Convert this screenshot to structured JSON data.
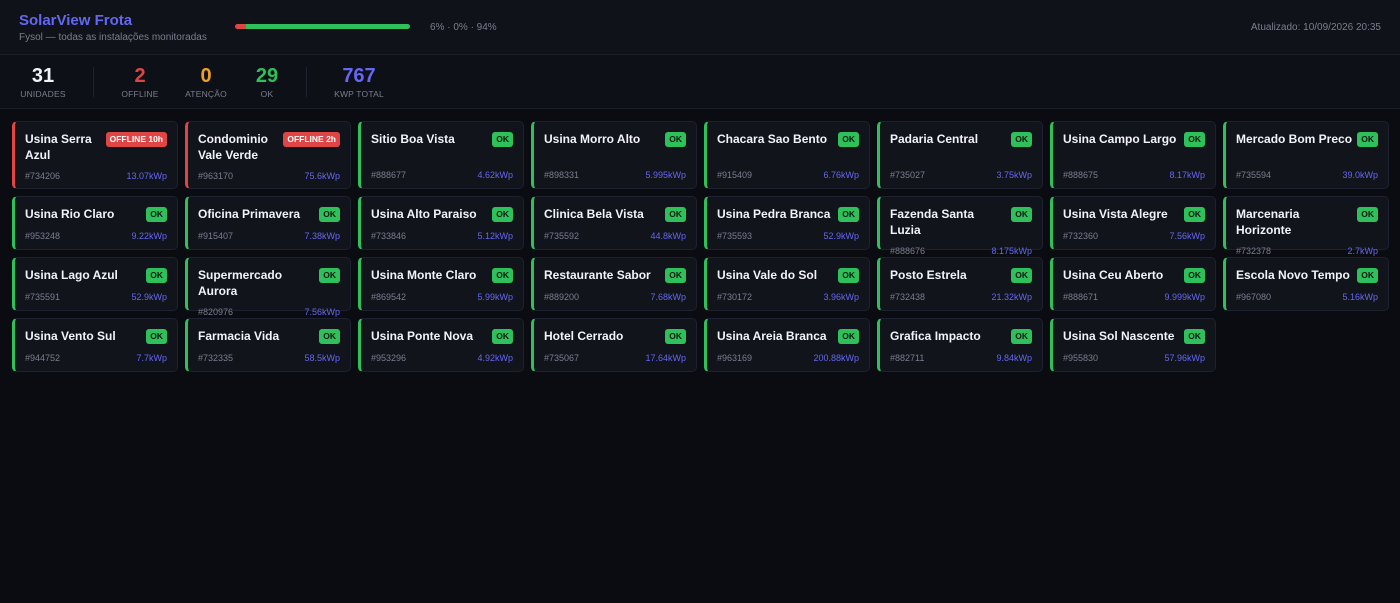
{
  "header": {
    "title": "SolarView Frota",
    "subtitle": "Fysol — todas as instalações monitoradas",
    "progress": {
      "offline_pct": 6,
      "attention_pct": 0,
      "ok_pct": 94,
      "text": "6% · 0% · 94%"
    },
    "updated": "Atualizado: 10/09/2026 20:35"
  },
  "colors": {
    "accent": "#6467f2",
    "offline": "#e04545",
    "attention": "#f0a020",
    "ok": "#2ec05a"
  },
  "stats": {
    "units": {
      "value": "31",
      "label": "UNIDADES"
    },
    "offline": {
      "value": "2",
      "label": "OFFLINE"
    },
    "attention": {
      "value": "0",
      "label": "ATENÇÃO"
    },
    "ok": {
      "value": "29",
      "label": "OK"
    },
    "kwp": {
      "value": "767",
      "label": "KWP TOTAL"
    }
  },
  "units": [
    {
      "name": "Usina Serra Azul",
      "status": "offline",
      "badge": "OFFLINE 10h",
      "id": "#734206",
      "kwp": "13.07kWp"
    },
    {
      "name": "Condominio Vale Verde",
      "status": "offline",
      "badge": "OFFLINE 2h",
      "id": "#963170",
      "kwp": "75.6kWp"
    },
    {
      "name": "Sitio Boa Vista",
      "status": "ok",
      "badge": "OK",
      "id": "#888677",
      "kwp": "4.62kWp"
    },
    {
      "name": "Usina Morro Alto",
      "status": "ok",
      "badge": "OK",
      "id": "#898331",
      "kwp": "5.995kWp"
    },
    {
      "name": "Chacara Sao Bento",
      "status": "ok",
      "badge": "OK",
      "id": "#915409",
      "kwp": "6.76kWp"
    },
    {
      "name": "Padaria Central",
      "status": "ok",
      "badge": "OK",
      "id": "#735027",
      "kwp": "3.75kWp"
    },
    {
      "name": "Usina Campo Largo",
      "status": "ok",
      "badge": "OK",
      "id": "#888675",
      "kwp": "8.17kWp"
    },
    {
      "name": "Mercado Bom Preco",
      "status": "ok",
      "badge": "OK",
      "id": "#735594",
      "kwp": "39.0kWp"
    },
    {
      "name": "Usina Rio Claro",
      "status": "ok",
      "badge": "OK",
      "id": "#953248",
      "kwp": "9.22kWp"
    },
    {
      "name": "Oficina Primavera",
      "status": "ok",
      "badge": "OK",
      "id": "#915407",
      "kwp": "7.38kWp"
    },
    {
      "name": "Usina Alto Paraiso",
      "status": "ok",
      "badge": "OK",
      "id": "#733846",
      "kwp": "5.12kWp"
    },
    {
      "name": "Clinica Bela Vista",
      "status": "ok",
      "badge": "OK",
      "id": "#735592",
      "kwp": "44.8kWp"
    },
    {
      "name": "Usina Pedra Branca",
      "status": "ok",
      "badge": "OK",
      "id": "#735593",
      "kwp": "52.9kWp"
    },
    {
      "name": "Fazenda Santa Luzia",
      "status": "ok",
      "badge": "OK",
      "id": "#888676",
      "kwp": "8.175kWp"
    },
    {
      "name": "Usina Vista Alegre",
      "status": "ok",
      "badge": "OK",
      "id": "#732360",
      "kwp": "7.56kWp"
    },
    {
      "name": "Marcenaria Horizonte",
      "status": "ok",
      "badge": "OK",
      "id": "#732378",
      "kwp": "2.7kWp"
    },
    {
      "name": "Usina Lago Azul",
      "status": "ok",
      "badge": "OK",
      "id": "#735591",
      "kwp": "52.9kWp"
    },
    {
      "name": "Supermercado Aurora",
      "status": "ok",
      "badge": "OK",
      "id": "#820976",
      "kwp": "7.56kWp"
    },
    {
      "name": "Usina Monte Claro",
      "status": "ok",
      "badge": "OK",
      "id": "#869542",
      "kwp": "5.99kWp"
    },
    {
      "name": "Restaurante Sabor",
      "status": "ok",
      "badge": "OK",
      "id": "#889200",
      "kwp": "7.68kWp"
    },
    {
      "name": "Usina Vale do Sol",
      "status": "ok",
      "badge": "OK",
      "id": "#730172",
      "kwp": "3.96kWp"
    },
    {
      "name": "Posto Estrela",
      "status": "ok",
      "badge": "OK",
      "id": "#732438",
      "kwp": "21.32kWp"
    },
    {
      "name": "Usina Ceu Aberto",
      "status": "ok",
      "badge": "OK",
      "id": "#888671",
      "kwp": "9.999kWp"
    },
    {
      "name": "Escola Novo Tempo",
      "status": "ok",
      "badge": "OK",
      "id": "#967080",
      "kwp": "5.16kWp"
    },
    {
      "name": "Usina Vento Sul",
      "status": "ok",
      "badge": "OK",
      "id": "#944752",
      "kwp": "7.7kWp"
    },
    {
      "name": "Farmacia Vida",
      "status": "ok",
      "badge": "OK",
      "id": "#732335",
      "kwp": "58.5kWp"
    },
    {
      "name": "Usina Ponte Nova",
      "status": "ok",
      "badge": "OK",
      "id": "#953296",
      "kwp": "4.92kWp"
    },
    {
      "name": "Hotel Cerrado",
      "status": "ok",
      "badge": "OK",
      "id": "#735067",
      "kwp": "17.64kWp"
    },
    {
      "name": "Usina Areia Branca",
      "status": "ok",
      "badge": "OK",
      "id": "#963169",
      "kwp": "200.88kWp"
    },
    {
      "name": "Grafica Impacto",
      "status": "ok",
      "badge": "OK",
      "id": "#882711",
      "kwp": "9.84kWp"
    },
    {
      "name": "Usina Sol Nascente",
      "status": "ok",
      "badge": "OK",
      "id": "#955830",
      "kwp": "57.96kWp"
    }
  ]
}
